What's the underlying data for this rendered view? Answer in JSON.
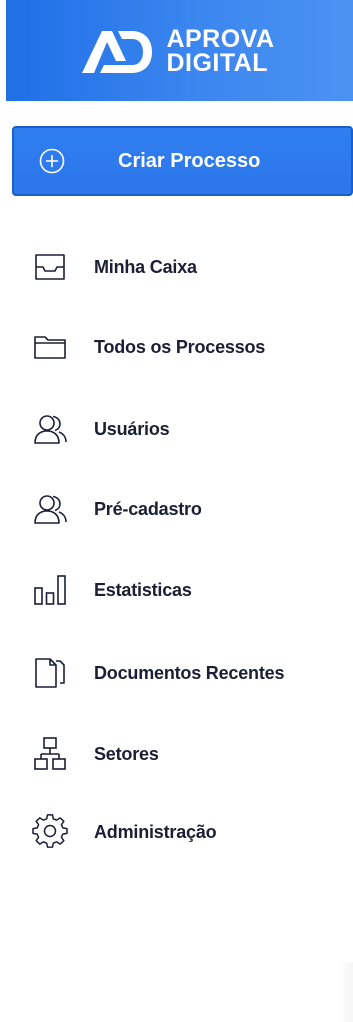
{
  "brand": {
    "line1": "APROVA",
    "line2": "DIGITAL",
    "background": "#2f7ef0"
  },
  "create_button": {
    "label": "Criar Processo",
    "icon": "plus-circle-icon"
  },
  "nav": [
    {
      "id": "minha-caixa",
      "label": "Minha Caixa",
      "icon": "inbox-icon"
    },
    {
      "id": "todos-processos",
      "label": "Todos os Processos",
      "icon": "folder-icon"
    },
    {
      "id": "usuarios",
      "label": "Usuários",
      "icon": "users-icon"
    },
    {
      "id": "pre-cadastro",
      "label": "Pré-cadastro",
      "icon": "users-icon"
    },
    {
      "id": "estatisticas",
      "label": "Estatisticas",
      "icon": "bar-chart-icon"
    },
    {
      "id": "documentos-recentes",
      "label": "Documentos Recentes",
      "icon": "documents-icon"
    },
    {
      "id": "setores",
      "label": "Setores",
      "icon": "sitemap-icon"
    },
    {
      "id": "administracao",
      "label": "Administração",
      "icon": "gear-icon"
    }
  ],
  "colors": {
    "accent": "#2f7ef0",
    "text": "#1a1f36"
  }
}
